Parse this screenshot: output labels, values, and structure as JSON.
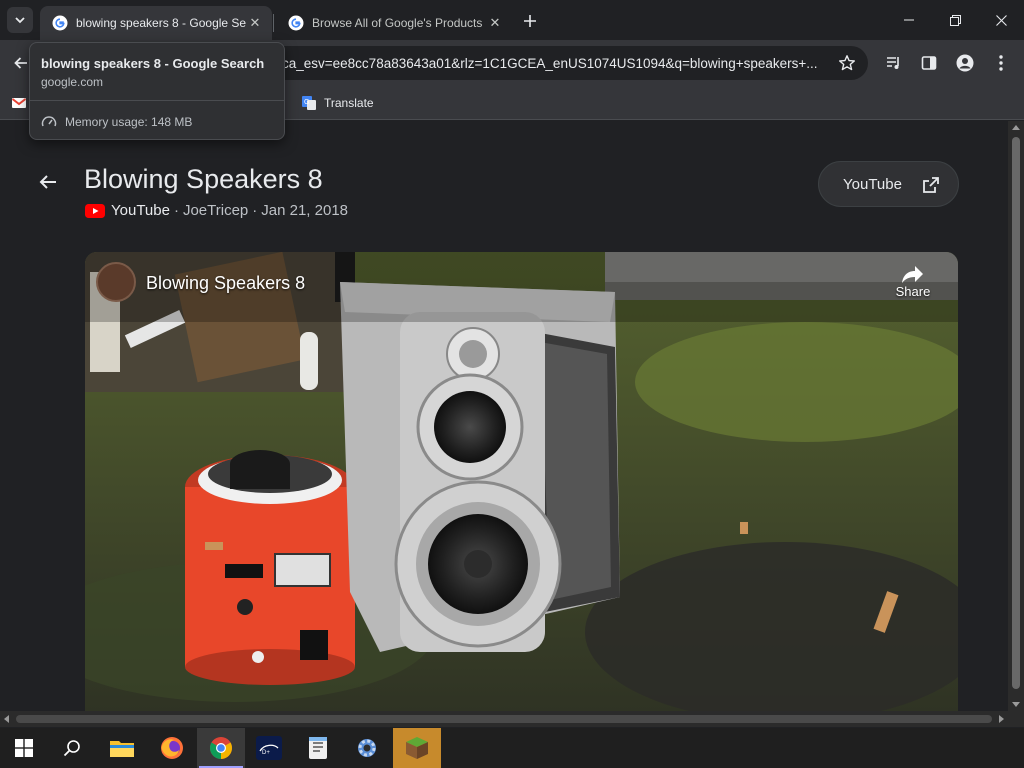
{
  "browser": {
    "tabs": [
      {
        "title": "blowing speakers 8 - Google Search",
        "active": true
      },
      {
        "title": "Browse All of Google's Products & Services",
        "active": false
      }
    ],
    "url": "ca_esv=ee8cc78a83643a01&rlz=1C1GCEA_enUS1074US1094&q=blowing+speakers+...",
    "bookmarks": [
      {
        "label": "Translate",
        "icon": "google-translate-icon"
      }
    ],
    "hover_card": {
      "title": "blowing speakers 8 - Google Search",
      "domain": "google.com",
      "memory": "Memory usage: 148 MB"
    }
  },
  "page": {
    "title": "Blowing Speakers 8",
    "source": "YouTube",
    "separator": "·",
    "channel": "JoeTricep",
    "date": "Jan 21, 2018",
    "youtube_button": "YouTube",
    "player": {
      "title": "Blowing Speakers 8",
      "share_label": "Share"
    }
  },
  "taskbar": {
    "apps": [
      "start-icon",
      "search-icon",
      "file-explorer-icon",
      "firefox-icon",
      "chrome-icon",
      "disney-plus-icon",
      "notepad-icon",
      "settings-icon",
      "minecraft-icon"
    ],
    "active": "chrome-icon"
  },
  "colors": {
    "background": "#202124",
    "toolbar": "#35363a",
    "youtube_red": "#ff0000",
    "variac_orange": "#e8472a",
    "speaker_silver": "#c9c9c9"
  }
}
